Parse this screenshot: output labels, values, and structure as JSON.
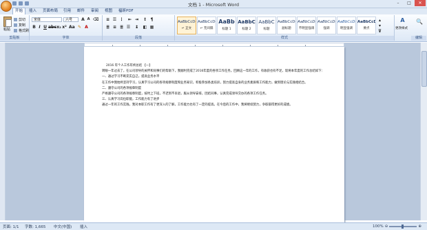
{
  "window": {
    "title": "文档 1 - Microsoft Word"
  },
  "quick_access": [
    "save-icon",
    "undo-icon",
    "redo-icon",
    "customize-icon"
  ],
  "tabs": [
    "开始",
    "插入",
    "页面布局",
    "引用",
    "邮件",
    "审阅",
    "视图",
    "福昕PDF"
  ],
  "ribbon": {
    "clipboard": {
      "paste": "粘贴",
      "cut": "剪切",
      "copy": "复制",
      "format_painter": "格式刷",
      "label": "剪贴板"
    },
    "font": {
      "name": "宋体",
      "size": "六号",
      "label": "字体"
    },
    "paragraph": {
      "label": "段落"
    },
    "styles": {
      "label": "样式",
      "items": [
        {
          "sample": "AaBbCcDd",
          "name": "↵ 正文",
          "active": true
        },
        {
          "sample": "AaBbCcDd",
          "name": "↵ 无间隔"
        },
        {
          "sample": "AaBb",
          "name": "标题 1"
        },
        {
          "sample": "AaBbC",
          "name": "标题 2"
        },
        {
          "sample": "AaBbC",
          "name": "标题"
        },
        {
          "sample": "AaBbCcDd",
          "name": "副标题"
        },
        {
          "sample": "AaBbCcDd",
          "name": "不明显强调"
        },
        {
          "sample": "AaBbCcDd",
          "name": "强调"
        },
        {
          "sample": "AaBbCcDd",
          "name": "明显强调"
        },
        {
          "sample": "AaBbCcDd",
          "name": "要点"
        }
      ],
      "change_styles": "更改样式"
    },
    "editing": {
      "label": "编辑"
    }
  },
  "document": {
    "paragraphs": [
      "2016 年个人工作年终总结 【一】",
      "转眼一年过去了，在公司领导的关怀和同事们的帮助下，我顺利完成了2016年度的各项工作任务。回顾这一年的工作，有收获也有不足，现将本年度的工作总结如下：",
      "一、通过学习不断充实自己，提高业务水平",
      "在工作中我始终坚持学习，认真学习公司的各项规章制度和业务知识，积极参加各类培训，努力提高自身的业务素质和工作能力，做到理论与实践相结合。",
      "二、遵守公司的各项规章制度",
      "严格遵守公司的各项规章制度，按时上下班，不迟到不早退，服从领导安排，团结同事，认真完成领导交办的各项工作任务。",
      "三、认真学习岗位职能，工作能力有了进步",
      "通过一年的工作实践，我对本职工作有了更深入的了解，工作能力也有了一定的提高。在今后的工作中，我将继续努力，争取取得更好的成绩。"
    ]
  },
  "status": {
    "page": "页面: 1/1",
    "words": "字数: 1,665",
    "lang": "中文(中国)",
    "mode": "插入",
    "zoom": "100%"
  }
}
